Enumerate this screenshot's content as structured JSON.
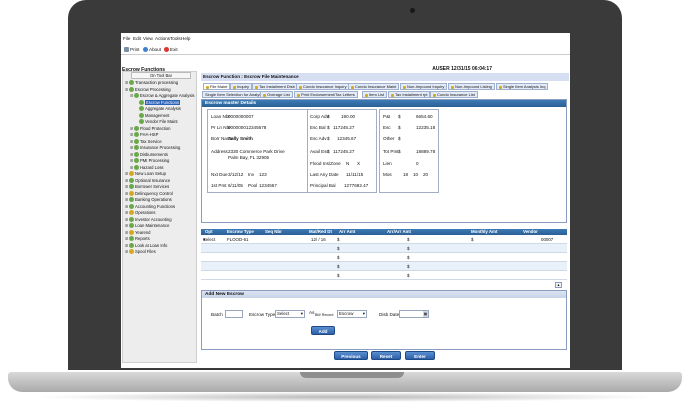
{
  "menu": [
    "File",
    "Edit",
    "View",
    "Actions",
    "Tools",
    "Help"
  ],
  "toolbar": {
    "print": "Print",
    "about": "About",
    "exit": "Exit"
  },
  "sidebar": {
    "title": "Escrow Functions",
    "on_toolbar": "On Tool Bar",
    "tree": [
      {
        "label": "Transaction processing",
        "indent": 0
      },
      {
        "label": "Escrow Processing",
        "indent": 0
      },
      {
        "label": "Escrow & Aggregate Analysis",
        "indent": 1
      },
      {
        "label": "Escrow Functions",
        "indent": 2,
        "selected": true
      },
      {
        "label": "Aggregate Analysis",
        "indent": 2
      },
      {
        "label": "Management",
        "indent": 2
      },
      {
        "label": "Vendor File Maint",
        "indent": 2
      },
      {
        "label": "Flood Protection",
        "indent": 1
      },
      {
        "label": "FHA-HSP",
        "indent": 1
      },
      {
        "label": "Tax Service",
        "indent": 1
      },
      {
        "label": "Insurance Processing",
        "indent": 1
      },
      {
        "label": "Disbursements",
        "indent": 1
      },
      {
        "label": "PMI Processing",
        "indent": 1
      },
      {
        "label": "Hazard Loss",
        "indent": 1
      },
      {
        "label": "New Loan Setup",
        "indent": 0
      },
      {
        "label": "Optional Insurance",
        "indent": 0
      },
      {
        "label": "Borrower Services",
        "indent": 0
      },
      {
        "label": "Delinquency Control",
        "indent": 0
      },
      {
        "label": "Banking Operations",
        "indent": 0
      },
      {
        "label": "Accounting Functions",
        "indent": 0
      },
      {
        "label": "Operations",
        "indent": 0
      },
      {
        "label": "Investor Accounting",
        "indent": 0
      },
      {
        "label": "Loan Maintenance",
        "indent": 0
      },
      {
        "label": "Yearend",
        "indent": 0
      },
      {
        "label": "Reports",
        "indent": 0
      },
      {
        "label": "Look at Loan Info",
        "indent": 0
      },
      {
        "label": "Spool Files",
        "indent": 0
      }
    ]
  },
  "header": {
    "user_datetime": "AUSER 12/31/15 06:04:17"
  },
  "function_title": "Escrow Function : Escrow File Maintenance",
  "tabs_row1": [
    "File Maint",
    "Inquiry",
    "Tax Installment Disb",
    "Condo Insurance Inquiry",
    "Condo Insurance Maint",
    "Non-Impound Inquiry",
    "Non-Impound Listing",
    "Single Item Analysis Inq"
  ],
  "tabs_row2": [
    "Single Item Selection for Analysis",
    "Overage List",
    "Print Endorsement/Tax Letters",
    "Item List",
    "Tax Installment rpt",
    "Condo Insurance List"
  ],
  "master": {
    "title": "Escrow master Details",
    "loan_nbr_label": "Loan Nbr",
    "loan_nbr": "0000000007",
    "pr_ln_nbr_label": "Pr Ln Nbr",
    "pr_ln_nbr": "000000012345678",
    "borr_name_label": "Borr Name",
    "borr_name": "Sally Smith",
    "address_label": "Address",
    "address_line1": "2330 Commerce Park Drive",
    "address_line2": "Palm Bay, FL 32905",
    "nxt_due_label": "Nxt Due",
    "nxt_due": "3/12/12",
    "inv_label": "Inv",
    "inv": "123",
    "first_pmt_label": "1st Pmt",
    "first_pmt": "6/11/05",
    "pool_label": "Pool",
    "pool": "1234567",
    "corp_adv_label": "Corp Adv",
    "corp_adv": "190.00",
    "esc_bal_label": "Esc Bal",
    "esc_bal": "117245.27",
    "esc_adv_label": "Esc Adv",
    "esc_adv": "12345.67",
    "avail_esc_label": "Avail Esc",
    "avail_esc": "117245.27",
    "flood_label": "Flood Ins/Zone",
    "flood_ins": "N",
    "flood_zone": "X",
    "last_date_label": "Last Any Date",
    "last_date": "11/11/15",
    "principal_label": "Principal Bal",
    "principal": "1277682.47",
    "pi_label": "P&I",
    "pi": "6654.60",
    "esc_label": "Esc",
    "esc": "12235.18",
    "other_label": "Other",
    "other": "",
    "tot_pmt_label": "Tot Pmt",
    "tot_pmt": "18889.78",
    "lien_label": "Lien",
    "lien": "0",
    "mos_label": "Mos",
    "mos_a": "18",
    "mos_b": "10",
    "mos_c": "20",
    "dollar": "$"
  },
  "grid": {
    "headers": [
      "Opt",
      "Escrow Type",
      "Seq Nbr",
      "Mat/Red Dt",
      "Arr Amt",
      "Arr/Arr Amt",
      "Monthly Amt",
      "Vendor"
    ],
    "row1": {
      "opt": "Select",
      "type": "FLOOD-61",
      "mat": "12/  / 16",
      "vendor": "00007"
    },
    "dollar": "$"
  },
  "add_escrow": {
    "title": "Add New Escrow",
    "batch_label": "Batch",
    "escrow_type_label": "Escrow Type",
    "escrow_type_value": "Select",
    "as_label": "As",
    "as_sub": "Bill/ Record",
    "as_value": "Escrow",
    "disb_date_label": "Disb Date",
    "add_button": "Add"
  },
  "nav": {
    "previous": "Previous",
    "reset": "Reset",
    "enter": "Enter"
  },
  "colors": {
    "accent": "#2a61b8",
    "title_bar": "#2a5f96",
    "tab_bg": "#e4ebf8"
  }
}
